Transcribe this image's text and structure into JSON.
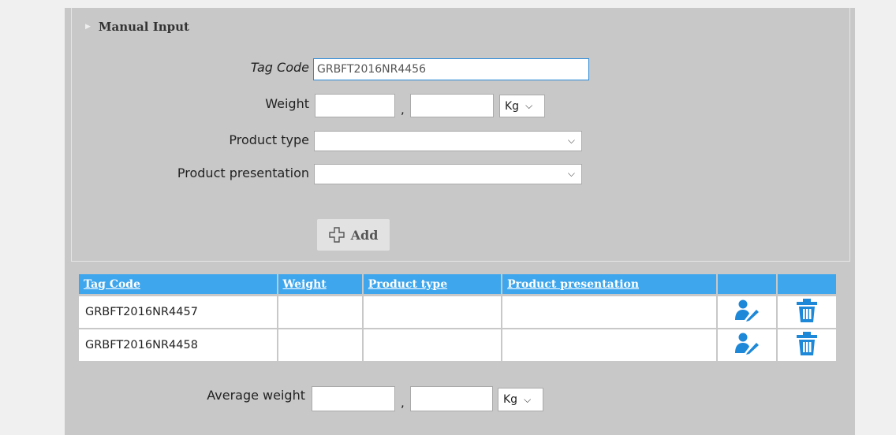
{
  "manual_input": {
    "title": "Manual Input",
    "tag_code_label": "Tag Code",
    "tag_code_value": "GRBFT2016NR4456",
    "weight_label": "Weight",
    "weight_int": "",
    "weight_dec": "",
    "separator": ",",
    "weight_unit": "Kg",
    "product_type_label": "Product type",
    "product_type_value": "",
    "product_presentation_label": "Product presentation",
    "product_presentation_value": "",
    "add_label": "Add"
  },
  "table": {
    "columns": [
      "Tag Code",
      "Weight",
      "Product type",
      "Product presentation",
      "",
      ""
    ],
    "rows": [
      {
        "tag_code": "GRBFT2016NR4457",
        "weight": "",
        "product_type": "",
        "product_presentation": ""
      },
      {
        "tag_code": "GRBFT2016NR4458",
        "weight": "",
        "product_type": "",
        "product_presentation": ""
      }
    ],
    "row_icons": [
      "edit-user-icon",
      "trash-icon"
    ]
  },
  "average": {
    "label": "Average weight",
    "int": "",
    "dec": "",
    "separator": ",",
    "unit": "Kg"
  },
  "colors": {
    "header_blue": "#3ea6ec",
    "icon_blue": "#1e88d8",
    "panel_gray": "#c8c8c8"
  }
}
